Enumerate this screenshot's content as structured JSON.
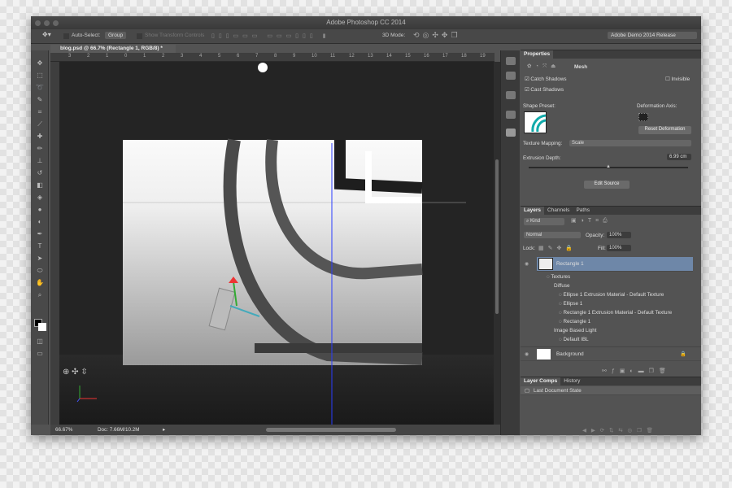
{
  "window": {
    "title": "Adobe Photoshop CC 2014"
  },
  "options": {
    "auto_select_label": "Auto-Select:",
    "auto_select_value": "Group",
    "show_transform": "Show Transform Controls",
    "mode_label": "3D Mode:",
    "workspace": "Adobe Demo 2014 Release"
  },
  "document": {
    "tab": "blog.psd @ 66.7% (Rectangle 1, RGB/8) *",
    "ruler_ticks": [
      "3",
      "2",
      "1",
      "0",
      "1",
      "2",
      "3",
      "4",
      "5",
      "6",
      "7",
      "8",
      "9",
      "10",
      "11",
      "12",
      "13",
      "14",
      "15",
      "16",
      "17",
      "18",
      "19"
    ]
  },
  "status": {
    "zoom": "66.67%",
    "doc": "Doc: 7.66M/10.2M"
  },
  "properties": {
    "title": "Properties",
    "section": "Mesh",
    "catch_shadows": "Catch Shadows",
    "cast_shadows": "Cast Shadows",
    "invisible": "Invisible",
    "shape_preset": "Shape Preset:",
    "deformation_axis": "Deformation Axis:",
    "reset_deformation": "Reset Deformation",
    "texture_mapping_label": "Texture Mapping:",
    "texture_mapping_value": "Scale",
    "extrusion_label": "Extrusion Depth:",
    "extrusion_value": "6.99 cm",
    "extrusion_slider_fraction": 0.5,
    "edit_source": "Edit Source",
    "catch_checked": true,
    "cast_checked": true,
    "invisible_checked": false
  },
  "layers": {
    "tabs": [
      "Layers",
      "Channels",
      "Paths"
    ],
    "filter": "Kind",
    "blend": "Normal",
    "opacity_label": "Opacity:",
    "opacity": "100%",
    "lock_label": "Lock:",
    "fill_label": "Fill:",
    "fill": "100%",
    "items": [
      {
        "name": "Rectangle 1",
        "selected": true
      },
      {
        "name": "Textures"
      },
      {
        "name": "Diffuse"
      },
      {
        "name": "Ellipse 1 Extrusion Material - Default Texture"
      },
      {
        "name": "Ellipse 1"
      },
      {
        "name": "Rectangle 1 Extrusion Material - Default Texture"
      },
      {
        "name": "Rectangle 1"
      },
      {
        "name": "Image Based Light"
      },
      {
        "name": "Default IBL"
      },
      {
        "name": "Background"
      }
    ]
  },
  "layer_comps": {
    "tabs": [
      "Layer Comps",
      "History"
    ],
    "items": [
      "Last Document State"
    ]
  },
  "colors": {
    "accent_selected": "#6e87a8",
    "panel": "#535353",
    "canvas": "#242424"
  }
}
